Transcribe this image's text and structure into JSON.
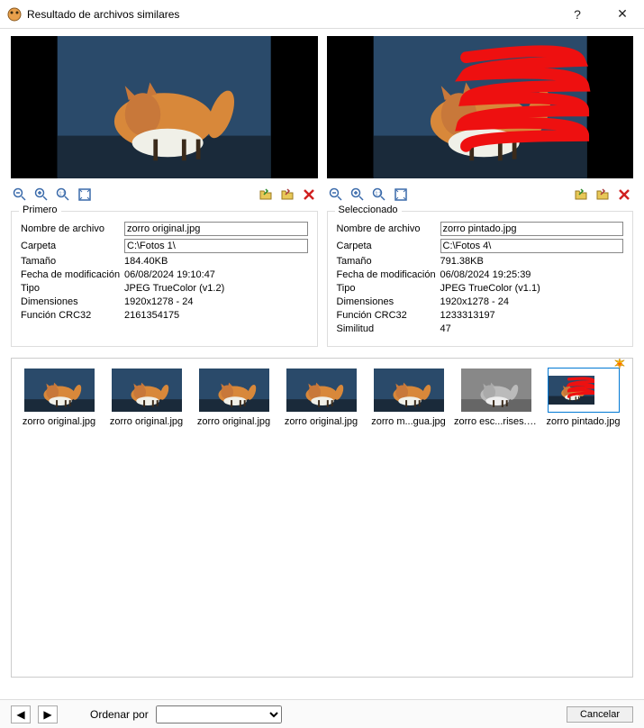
{
  "window": {
    "title": "Resultado de archivos similares"
  },
  "panels": {
    "left": {
      "legend": "Primero",
      "fields": {
        "filename_label": "Nombre de archivo",
        "filename_value": "zorro original.jpg",
        "folder_label": "Carpeta",
        "folder_value": "C:\\Fotos 1\\",
        "size_label": "Tamaño",
        "size_value": "184.40KB",
        "modified_label": "Fecha de modificación",
        "modified_value": "06/08/2024 19:10:47",
        "type_label": "Tipo",
        "type_value": "JPEG TrueColor (v1.2)",
        "dims_label": "Dimensiones",
        "dims_value": "1920x1278 - 24",
        "crc_label": "Función CRC32",
        "crc_value": "2161354175"
      }
    },
    "right": {
      "legend": "Seleccionado",
      "fields": {
        "filename_label": "Nombre de archivo",
        "filename_value": "zorro pintado.jpg",
        "folder_label": "Carpeta",
        "folder_value": "C:\\Fotos 4\\",
        "size_label": "Tamaño",
        "size_value": "791.38KB",
        "modified_label": "Fecha de modificación",
        "modified_value": "06/08/2024 19:25:39",
        "type_label": "Tipo",
        "type_value": "JPEG TrueColor (v1.1)",
        "dims_label": "Dimensiones",
        "dims_value": "1920x1278 - 24",
        "crc_label": "Función CRC32",
        "crc_value": "1233313197",
        "similarity_label": "Similitud",
        "similarity_value": "47"
      }
    }
  },
  "thumbnails": [
    {
      "caption": "zorro original.jpg",
      "variant": "fox"
    },
    {
      "caption": "zorro original.jpg",
      "variant": "fox"
    },
    {
      "caption": "zorro original.jpg",
      "variant": "fox"
    },
    {
      "caption": "zorro original.jpg",
      "variant": "fox"
    },
    {
      "caption": "zorro m...gua.jpg",
      "variant": "fox"
    },
    {
      "caption": "zorro esc...rises.jpg",
      "variant": "gray"
    },
    {
      "caption": "zorro pintado.jpg",
      "variant": "painted"
    }
  ],
  "bottombar": {
    "sort_label": "Ordenar por",
    "cancel_label": "Cancelar"
  }
}
